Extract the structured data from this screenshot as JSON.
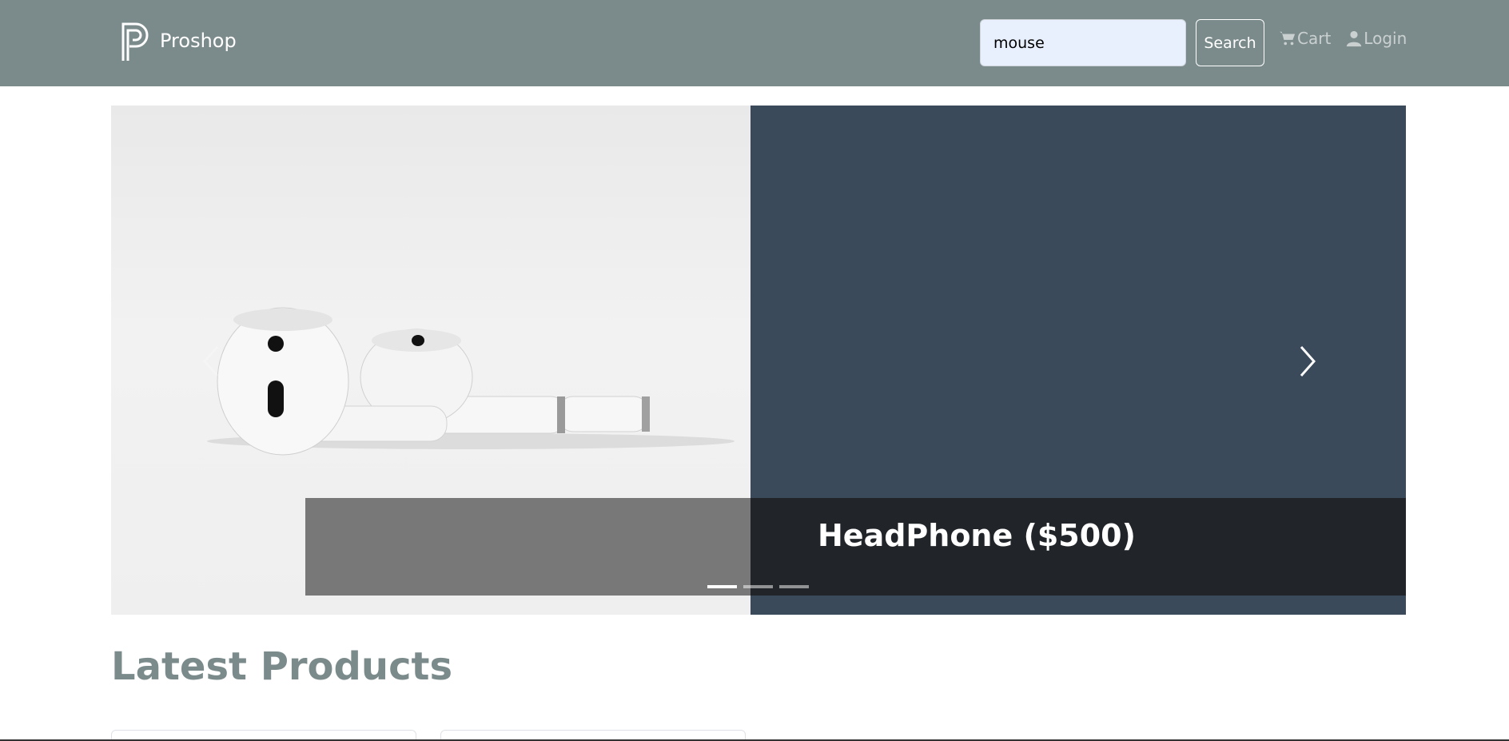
{
  "navbar": {
    "brand": "Proshop",
    "search": {
      "value": "mouse",
      "button_label": "Search"
    },
    "links": [
      {
        "label": "Cart",
        "icon": "cart-icon"
      },
      {
        "label": "Login",
        "icon": "user-icon"
      }
    ],
    "background_color": "#7b8a8b"
  },
  "carousel": {
    "caption": "HeadPhone ($500)",
    "slide_count": 3,
    "active_index": 0,
    "background_color": "#3a4a5b"
  },
  "main": {
    "section_title": "Latest Products"
  }
}
